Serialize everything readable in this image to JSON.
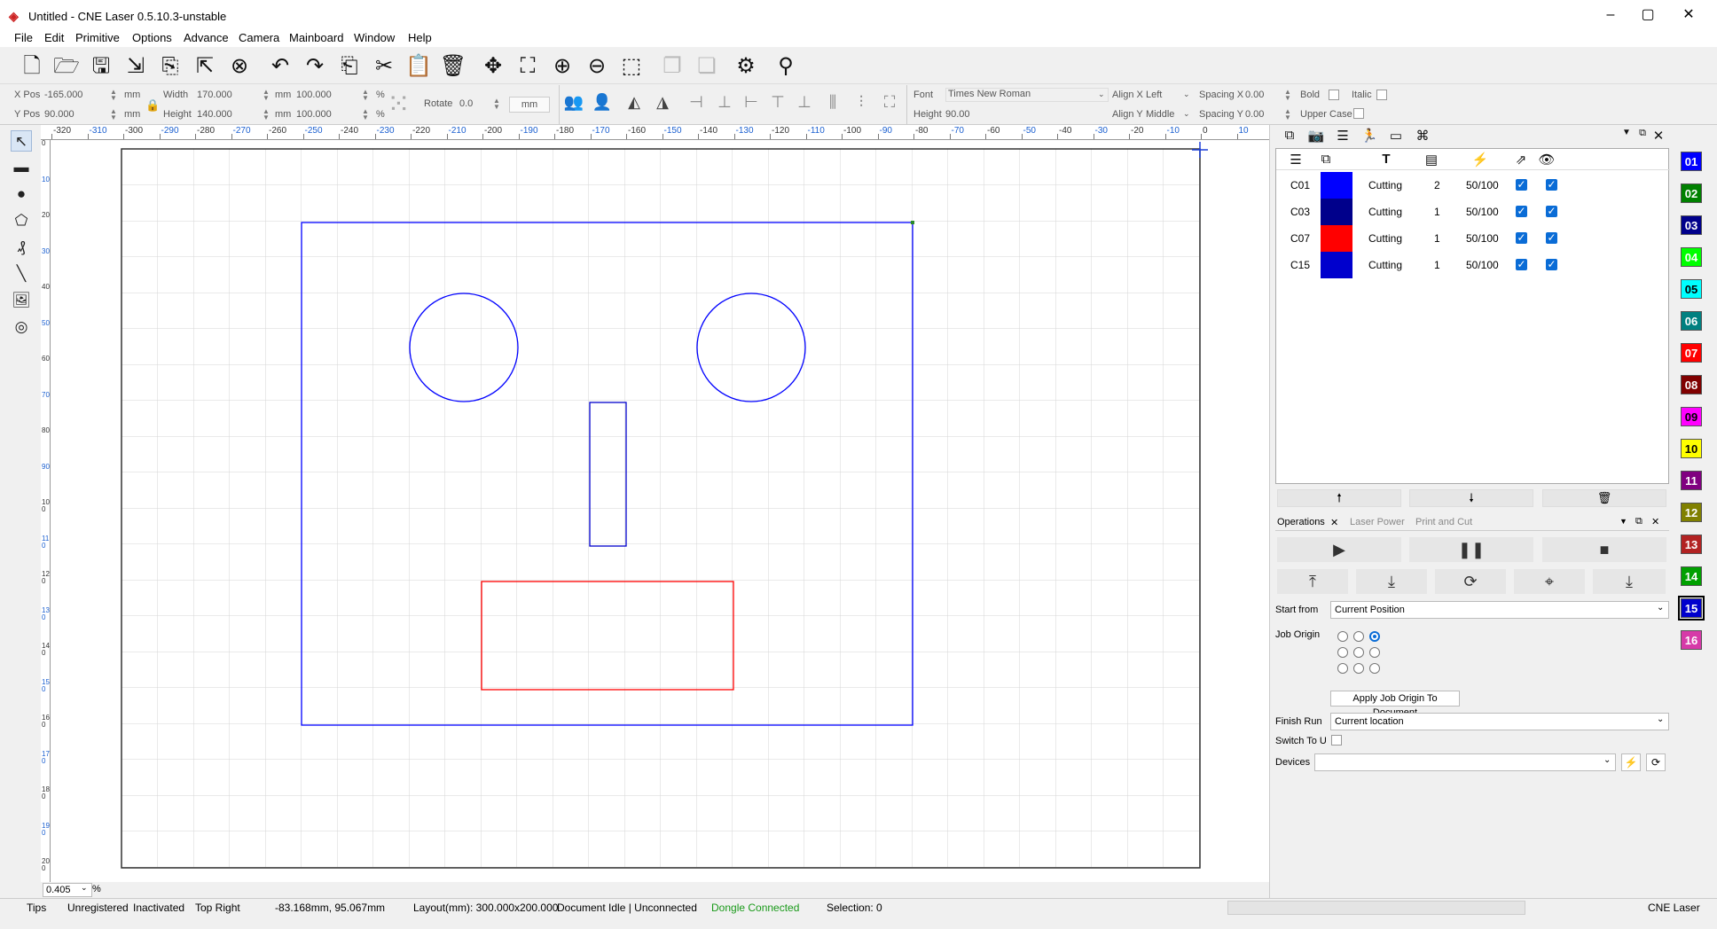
{
  "window": {
    "title": "Untitled - CNE Laser 0.5.10.3-unstable",
    "minimize": "–",
    "maximize": "▢",
    "close": "✕"
  },
  "menu": [
    "File",
    "Edit",
    "Primitive",
    "Options",
    "Advance",
    "Camera",
    "Mainboard",
    "Window",
    "Help"
  ],
  "props": {
    "xpos_label": "X Pos",
    "xpos": "-165.000",
    "ypos_label": "Y Pos",
    "ypos": "90.000",
    "unit_mm": "mm",
    "width_label": "Width",
    "width": "170.000",
    "height_label": "Height",
    "height": "140.000",
    "scale_w": "100.000",
    "scale_h": "100.000",
    "percent": "%",
    "rotate_label": "Rotate",
    "rotate": "0.0",
    "rotate_unit": "mm",
    "font_label": "Font",
    "font": "Times New Roman",
    "text_height_label": "Height",
    "text_height": "90.00",
    "align_x_label": "Align X",
    "align_x": "Left",
    "align_y_label": "Align Y",
    "align_y": "Middle",
    "spacing_x_label": "Spacing X",
    "spacing_x": "0.00",
    "spacing_y_label": "Spacing Y",
    "spacing_y": "0.00",
    "bold_label": "Bold",
    "italic_label": "Italic",
    "upper_label": "Upper Case"
  },
  "ruler": {
    "h_ticks": [
      "-320",
      "-310",
      "-300",
      "-290",
      "-280",
      "-270",
      "-260",
      "-250",
      "-240",
      "-230",
      "-220",
      "-210",
      "-200",
      "-190",
      "-180",
      "-170",
      "-160",
      "-150",
      "-140",
      "-130",
      "-120",
      "-110",
      "-100",
      "-90",
      "-80",
      "-70",
      "-60",
      "-50",
      "-40",
      "-30",
      "-20",
      "-10",
      "0",
      "10"
    ],
    "v_ticks": [
      "0",
      "10",
      "20",
      "30",
      "40",
      "50",
      "60",
      "70",
      "80",
      "90",
      "100",
      "110",
      "120",
      "130",
      "140",
      "150",
      "160",
      "170",
      "180",
      "190",
      "200"
    ]
  },
  "zoom": {
    "value": "0.405",
    "unit": "%"
  },
  "status": {
    "tips": "Tips",
    "reg": "Unregistered",
    "act": "Inactivated",
    "origin": "Top Right",
    "coords": "-83.168mm,  95.067mm",
    "layout": "Layout(mm): 300.000x200.000",
    "doc": "Document Idle | Unconnected",
    "dongle": "Dongle Connected",
    "selection": "Selection: 0",
    "app": "CNE Laser"
  },
  "layers": {
    "rows": [
      {
        "name": "C01",
        "color": "#0000ff",
        "mode": "Cutting",
        "passes": "2",
        "speed": "50/100"
      },
      {
        "name": "C03",
        "color": "#00008b",
        "mode": "Cutting",
        "passes": "1",
        "speed": "50/100"
      },
      {
        "name": "C07",
        "color": "#ff0000",
        "mode": "Cutting",
        "passes": "1",
        "speed": "50/100"
      },
      {
        "name": "C15",
        "color": "#0000cd",
        "mode": "Cutting",
        "passes": "1",
        "speed": "50/100"
      }
    ]
  },
  "ops": {
    "tab_operations": "Operations",
    "tab_close": "✕",
    "tab_power": "Laser Power",
    "tab_print": "Print and Cut",
    "start_from_label": "Start from",
    "start_from": "Current Position",
    "job_origin_label": "Job Origin",
    "apply_btn": "Apply Job Origin To Document",
    "finish_label": "Finish Run",
    "finish": "Current location",
    "switch_label": "Switch To U",
    "devices_label": "Devices",
    "devices": ""
  },
  "palette": [
    {
      "n": "01",
      "bg": "#0000ff",
      "fg": "#fff"
    },
    {
      "n": "02",
      "bg": "#008000",
      "fg": "#fff"
    },
    {
      "n": "03",
      "bg": "#00008b",
      "fg": "#fff"
    },
    {
      "n": "04",
      "bg": "#00ff00",
      "fg": "#fff"
    },
    {
      "n": "05",
      "bg": "#00ffff",
      "fg": "#000"
    },
    {
      "n": "06",
      "bg": "#008080",
      "fg": "#fff"
    },
    {
      "n": "07",
      "bg": "#ff0000",
      "fg": "#fff"
    },
    {
      "n": "08",
      "bg": "#800000",
      "fg": "#fff"
    },
    {
      "n": "09",
      "bg": "#ff00ff",
      "fg": "#000"
    },
    {
      "n": "10",
      "bg": "#ffff00",
      "fg": "#000"
    },
    {
      "n": "11",
      "bg": "#800080",
      "fg": "#fff"
    },
    {
      "n": "12",
      "bg": "#808000",
      "fg": "#fff"
    },
    {
      "n": "13",
      "bg": "#b22222",
      "fg": "#fff"
    },
    {
      "n": "14",
      "bg": "#00a000",
      "fg": "#fff"
    },
    {
      "n": "15",
      "bg": "#0000cd",
      "fg": "#fff"
    },
    {
      "n": "16",
      "bg": "#d63aa8",
      "fg": "#fff"
    }
  ]
}
